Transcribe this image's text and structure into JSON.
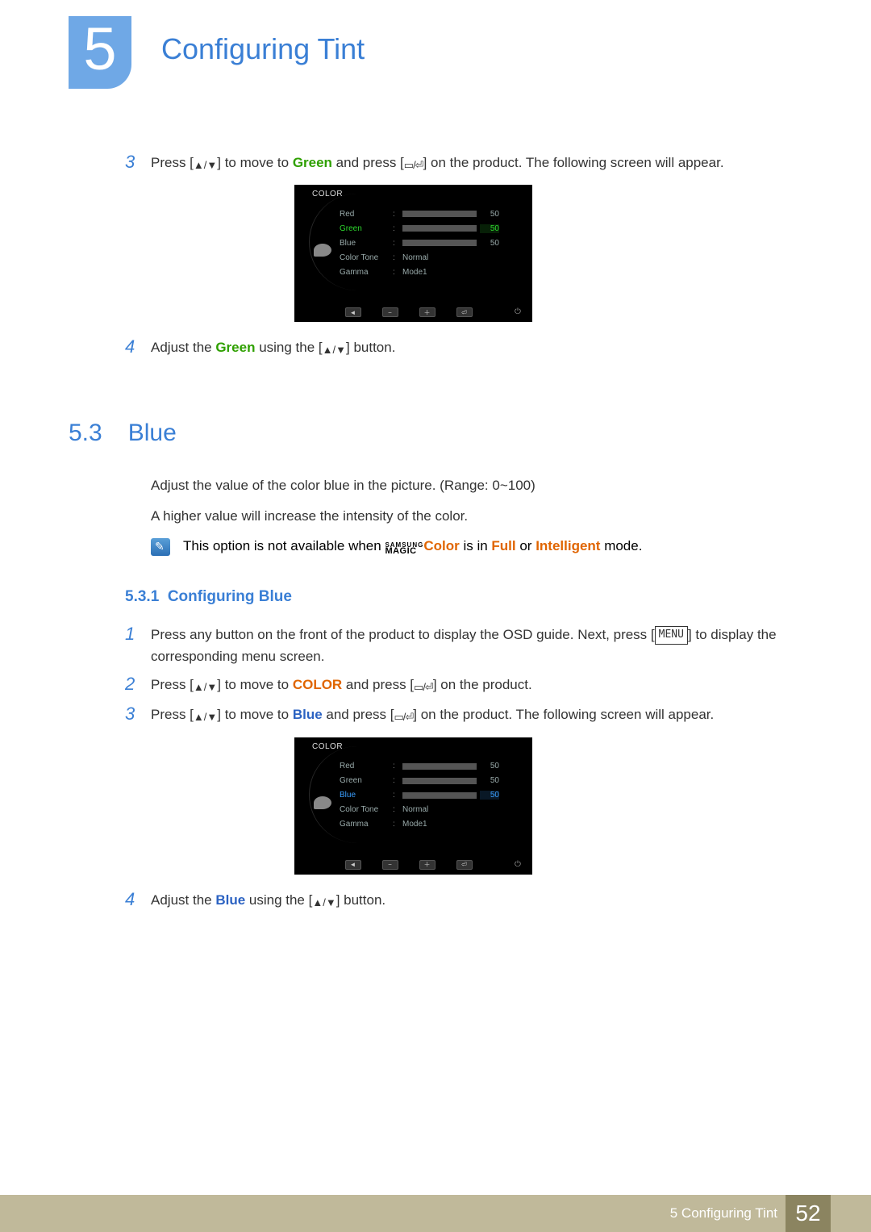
{
  "chapter": {
    "number": "5",
    "title": "Configuring Tint"
  },
  "top_steps": {
    "s3": {
      "num": "3",
      "pre": "Press [",
      "mid1": "] to move to ",
      "green": "Green",
      "mid2": " and press [",
      "post": "] on the product. The following screen will appear."
    },
    "s4": {
      "num": "4",
      "pre": "Adjust the ",
      "green": "Green",
      "mid": " using the [",
      "post": "] button."
    }
  },
  "osd_green": {
    "title": "COLOR",
    "rows": [
      {
        "label": "Red",
        "value": "50",
        "fill": 50,
        "color": "gray",
        "highlight": ""
      },
      {
        "label": "Green",
        "value": "50",
        "fill": 60,
        "color": "green",
        "highlight": "green"
      },
      {
        "label": "Blue",
        "value": "50",
        "fill": 50,
        "color": "gray",
        "highlight": ""
      }
    ],
    "text_rows": [
      {
        "label": "Color Tone",
        "value": "Normal"
      },
      {
        "label": "Gamma",
        "value": "Mode1"
      }
    ],
    "nav": [
      "◄",
      "−",
      "＋",
      "⏎"
    ]
  },
  "section": {
    "num": "5.3",
    "title": "Blue"
  },
  "section_body": {
    "p1": "Adjust the value of the color blue in the picture. (Range: 0~100)",
    "p2": "A higher value will increase the intensity of the color.",
    "note_pre": "This option is not available when ",
    "note_color": "Color",
    "note_mid": " is in ",
    "note_full": "Full",
    "note_or": " or ",
    "note_intel": "Intelligent",
    "note_post": " mode."
  },
  "subsection": {
    "num": "5.3.1",
    "title": "Configuring Blue"
  },
  "blue_steps": {
    "s1": {
      "num": "1",
      "pre": "Press any button on the front of the product to display the OSD guide. Next, press [",
      "menu": "MENU",
      "post": "] to display the corresponding menu screen."
    },
    "s2": {
      "num": "2",
      "pre": "Press [",
      "mid1": "] to move to ",
      "color": "COLOR",
      "mid2": " and press [",
      "post": "] on the product."
    },
    "s3": {
      "num": "3",
      "pre": "Press [",
      "mid1": "] to move to ",
      "blue": "Blue",
      "mid2": " and press [",
      "post": "] on the product. The following screen will appear."
    },
    "s4": {
      "num": "4",
      "pre": "Adjust the ",
      "blue": "Blue",
      "mid": " using the [",
      "post": "] button."
    }
  },
  "osd_blue": {
    "title": "COLOR",
    "rows": [
      {
        "label": "Red",
        "value": "50",
        "fill": 50,
        "color": "gray",
        "highlight": ""
      },
      {
        "label": "Green",
        "value": "50",
        "fill": 50,
        "color": "gray",
        "highlight": ""
      },
      {
        "label": "Blue",
        "value": "50",
        "fill": 60,
        "color": "blue",
        "highlight": "blue"
      }
    ],
    "text_rows": [
      {
        "label": "Color Tone",
        "value": "Normal"
      },
      {
        "label": "Gamma",
        "value": "Mode1"
      }
    ],
    "nav": [
      "◄",
      "−",
      "＋",
      "⏎"
    ]
  },
  "footer": {
    "text": "5 Configuring Tint",
    "page": "52"
  }
}
